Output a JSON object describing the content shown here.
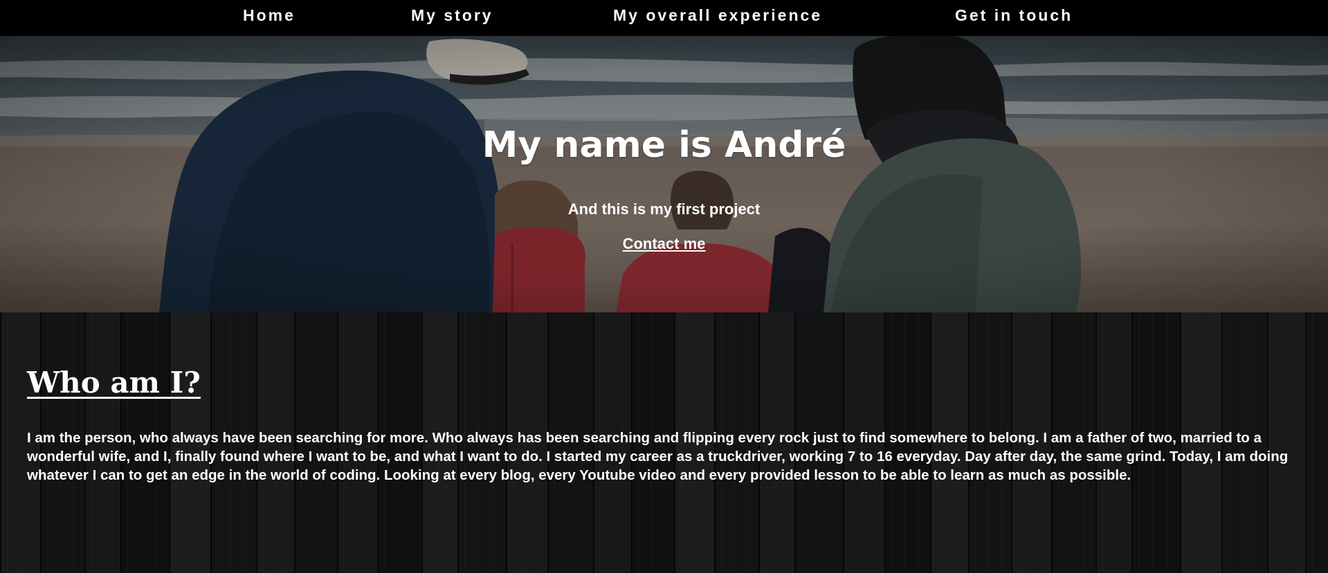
{
  "nav": {
    "items": [
      {
        "label": "Home"
      },
      {
        "label": "My story"
      },
      {
        "label": "My overall experience"
      },
      {
        "label": "Get in touch"
      }
    ]
  },
  "hero": {
    "title": "My name is André",
    "subtitle": "And this is my first project",
    "contact_link": "Contact me"
  },
  "about": {
    "heading": "Who am I?",
    "body": "I am the person, who always have been searching for more. Who always has been searching and flipping every rock just to find somewhere to belong. I am a father of two, married to a wonderful wife, and I, finally found where I want to be, and what I want to do. I started my career as a truckdriver, working 7 to 16 everyday. Day after day, the same grind. Today, I am doing whatever I can to get an edge in the world of coding. Looking at every blog, every Youtube video and every provided lesson to be able to learn as much as possible."
  },
  "colors": {
    "nav_background": "#000000",
    "text": "#ffffff",
    "section_background": "#141414"
  }
}
